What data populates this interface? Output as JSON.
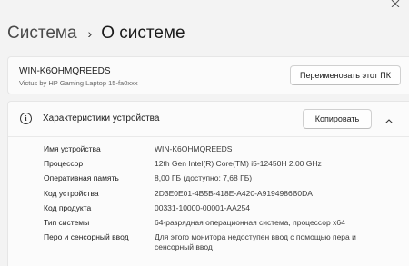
{
  "breadcrumb": {
    "parent": "Система",
    "separator": "›",
    "current": "О системе"
  },
  "device": {
    "name": "WIN-K6OHMQREEDS",
    "model": "Victus by HP Gaming Laptop 15-fa0xxx",
    "rename_button": "Переименовать этот ПК"
  },
  "specs": {
    "title": "Характеристики устройства",
    "copy_button": "Копировать",
    "rows": [
      {
        "label": "Имя устройства",
        "value": "WIN-K6OHMQREEDS"
      },
      {
        "label": "Процессор",
        "value": "12th Gen Intel(R) Core(TM) i5-12450H   2.00 GHz"
      },
      {
        "label": "Оперативная память",
        "value": "8,00 ГБ (доступно: 7,68 ГБ)"
      },
      {
        "label": "Код устройства",
        "value": "2D3E0E01-4B5B-418E-A420-A9194986B0DA"
      },
      {
        "label": "Код продукта",
        "value": "00331-10000-00001-AA254"
      },
      {
        "label": "Тип системы",
        "value": "64-разрядная операционная система, процессор x64"
      },
      {
        "label": "Перо и сенсорный ввод",
        "value": "Для этого монитора недоступен ввод с помощью пера и сенсорный ввод"
      }
    ]
  },
  "icons": {
    "window_close": "close-icon",
    "specs_info": "info-icon",
    "collapse": "chevron-up-icon"
  }
}
